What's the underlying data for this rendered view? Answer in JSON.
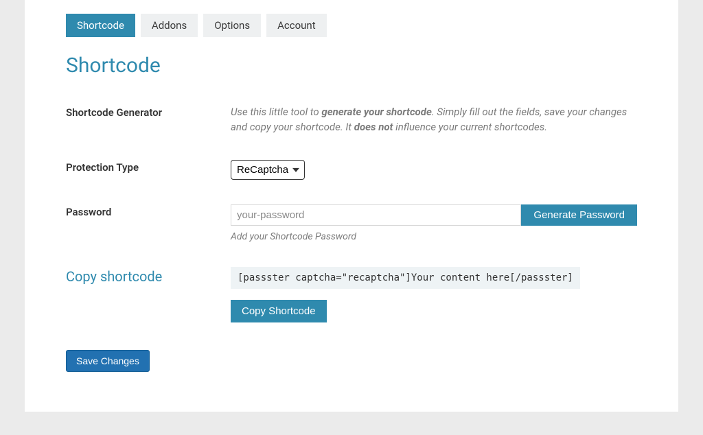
{
  "tabs": {
    "shortcode": "Shortcode",
    "addons": "Addons",
    "options": "Options",
    "account": "Account"
  },
  "heading": "Shortcode",
  "generator": {
    "label": "Shortcode Generator",
    "intro_pre": "Use this little tool to ",
    "intro_bold1": "generate your shortcode",
    "intro_mid": ". Simply fill out the fields, save your changes and copy your shortcode. It ",
    "intro_bold2": "does not",
    "intro_post": " influence your current shortcodes."
  },
  "protection": {
    "label": "Protection Type",
    "selected": "ReCaptcha"
  },
  "password": {
    "label": "Password",
    "placeholder": "your-password",
    "button": "Generate Password",
    "helper": "Add your Shortcode Password"
  },
  "copy": {
    "label": "Copy shortcode",
    "code": "[passster captcha=\"recaptcha\"]Your content here[/passster]",
    "button": "Copy Shortcode"
  },
  "save": "Save Changes"
}
